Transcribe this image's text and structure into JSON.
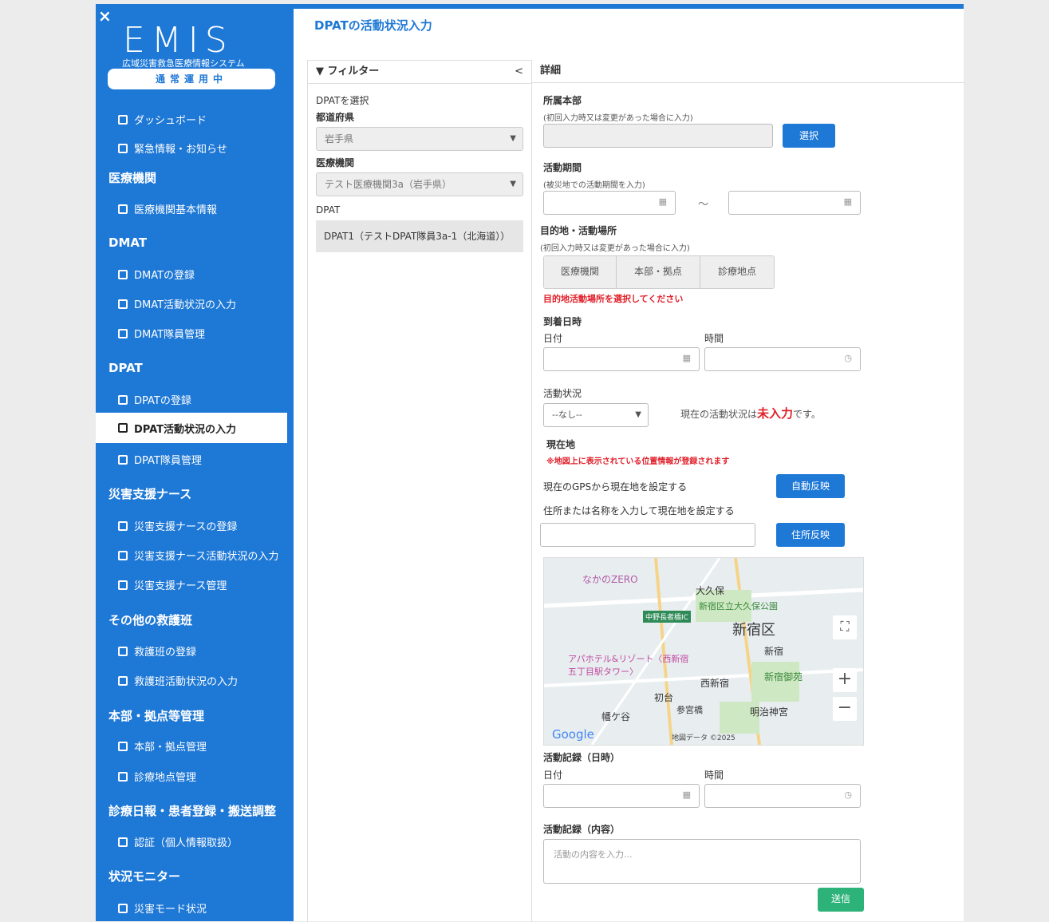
{
  "sidebar": {
    "close": "×",
    "logo": "EMIS",
    "logo_sub": "広域災害救急医療情報システム",
    "status": "通常運用中",
    "items": [
      {
        "label": "ダッシュボード"
      },
      {
        "label": "緊急情報・お知らせ"
      },
      {
        "label": "医療機関基本情報"
      },
      {
        "label": "DMATの登録"
      },
      {
        "label": "DMAT活動状況の入力"
      },
      {
        "label": "DMAT隊員管理"
      },
      {
        "label": "DPATの登録"
      },
      {
        "label": "DPAT活動状況の入力"
      },
      {
        "label": "DPAT隊員管理"
      },
      {
        "label": "災害支援ナースの登録"
      },
      {
        "label": "災害支援ナース活動状況の入力"
      },
      {
        "label": "災害支援ナース管理"
      },
      {
        "label": "救護班の登録"
      },
      {
        "label": "救護班活動状況の入力"
      },
      {
        "label": "本部・拠点管理"
      },
      {
        "label": "診療地点管理"
      },
      {
        "label": "認証（個人情報取扱）"
      },
      {
        "label": "災害モード状況"
      }
    ],
    "sections": [
      "医療機関",
      "DMAT",
      "DPAT",
      "災害支援ナース",
      "その他の救護班",
      "本部・拠点等管理",
      "診療日報・患者登録・搬送調整",
      "状況モニター"
    ]
  },
  "main": {
    "title": "DPATの活動状況入力",
    "filter": {
      "head": "フィルター",
      "collapse": "<",
      "select_dpat": "DPATを選択",
      "pref_label": "都道府県",
      "pref_value": "岩手県",
      "inst_label": "医療機関",
      "inst_value": "テスト医療機関3a（岩手県）",
      "dpat_label": "DPAT",
      "dpat_value": "DPAT1（テストDPAT隊員3a-1（北海道））"
    },
    "detail": {
      "head": "詳細",
      "hq_label": "所属本部",
      "hq_note": "(初回入力時又は変更があった場合に入力)",
      "select_btn": "選択",
      "period_label": "活動期間",
      "period_note": "(被災地での活動期間を入力)",
      "tilde": "～",
      "dest_label": "目的地・活動場所",
      "dest_note": "(初回入力時又は変更があった場合に入力)",
      "dest_options": [
        "医療機関",
        "本部・拠点",
        "診療地点"
      ],
      "dest_error": "目的地活動場所を選択してください",
      "arrival_label": "到着日時",
      "date_label": "日付",
      "time_label": "時間",
      "status_label": "活動状況",
      "status_value": "--なし--",
      "status_msg_pre": "現在の活動状況は",
      "status_msg_val": "未入力",
      "status_msg_post": "です。",
      "loc_label": "現在地",
      "loc_note": "※地図上に表示されている位置情報が登録されます",
      "gps_text": "現在のGPSから現在地を設定する",
      "auto_btn": "自動反映",
      "addr_text": "住所または名称を入力して現在地を設定する",
      "addr_btn": "住所反映",
      "map_labels": [
        "なかのZERO",
        "大久保",
        "新宿区立大久保公園",
        "中野長者橋IC",
        "新宿区",
        "アパホテル&リゾート〈西新宿五丁目駅タワー〉",
        "新宿",
        "新宿御苑",
        "西新宿",
        "初台",
        "参宮橋",
        "幡ケ谷",
        "明治神宮",
        "Google",
        "地図データ ©2025"
      ],
      "record_dt_label": "活動記録（日時）",
      "record_content_label": "活動記録（内容）",
      "record_placeholder": "活動の内容を入力...",
      "send_btn": "送信"
    }
  }
}
